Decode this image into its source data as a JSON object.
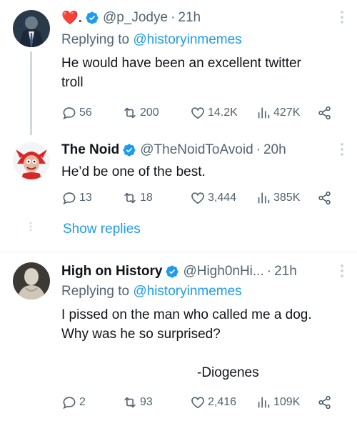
{
  "tweets": [
    {
      "name": "❤️.",
      "handle": "@p_Jodye",
      "sep": "·",
      "time": "21h",
      "reply_prefix": "Replying to",
      "reply_to": "@historyinmemes",
      "text_lines": [
        "He would have been an excellent twitter",
        "troll"
      ],
      "replies": "56",
      "retweets": "200",
      "likes": "14.2K",
      "views": "427K"
    },
    {
      "name": "The Noid",
      "handle": "@TheNoidToAvoid",
      "sep": "·",
      "time": "20h",
      "text_lines": [
        "He’d be one of the best."
      ],
      "replies": "13",
      "retweets": "18",
      "likes": "3,444",
      "views": "385K"
    },
    {
      "name": "High on History",
      "handle": "@High0nHi...",
      "sep": "·",
      "time": "21h",
      "reply_prefix": "Replying to",
      "reply_to": "@historyinmemes",
      "text_lines": [
        "I pissed on the man who called me a dog.",
        "Why was he so surprised?",
        "-Diogenes"
      ],
      "replies": "2",
      "retweets": "93",
      "likes": "2,416",
      "views": "109K"
    }
  ],
  "show_replies": "Show replies",
  "colors": {
    "accent": "#1d9bf0",
    "muted": "#536471",
    "text": "#0f1419",
    "line": "#cfd9de"
  }
}
